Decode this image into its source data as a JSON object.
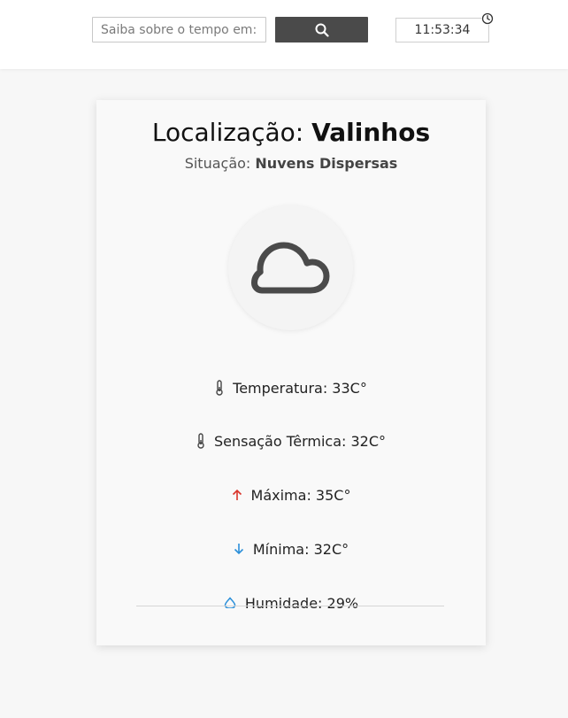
{
  "search": {
    "placeholder": "Saiba sobre o tempo em:",
    "button_icon": "search-icon"
  },
  "clock": {
    "time": "11:53:34",
    "icon": "clock-icon"
  },
  "location": {
    "label": "Localização:",
    "city": "Valinhos"
  },
  "situation": {
    "label": "Situação:",
    "value": "Nuvens Dispersas"
  },
  "weather_icon": "cloud-icon",
  "stats": [
    {
      "icon": "thermometer-icon",
      "label": "Temperatura: 33C°",
      "color": "#444444"
    },
    {
      "icon": "thermometer-icon",
      "label": "Sensação Têrmica: 32C°",
      "color": "#444444"
    },
    {
      "icon": "arrow-up-icon",
      "label": "Máxima: 35C°",
      "color": "#d9342b"
    },
    {
      "icon": "arrow-down-icon",
      "label": "Mínima: 32C°",
      "color": "#2b8fd9"
    },
    {
      "icon": "droplet-icon",
      "label": "Humidade: 29%",
      "color": "#2b8fd9"
    }
  ],
  "colors": {
    "search_button": "#4a4a4a",
    "max_arrow": "#d9342b",
    "min_arrow": "#2b8fd9"
  }
}
